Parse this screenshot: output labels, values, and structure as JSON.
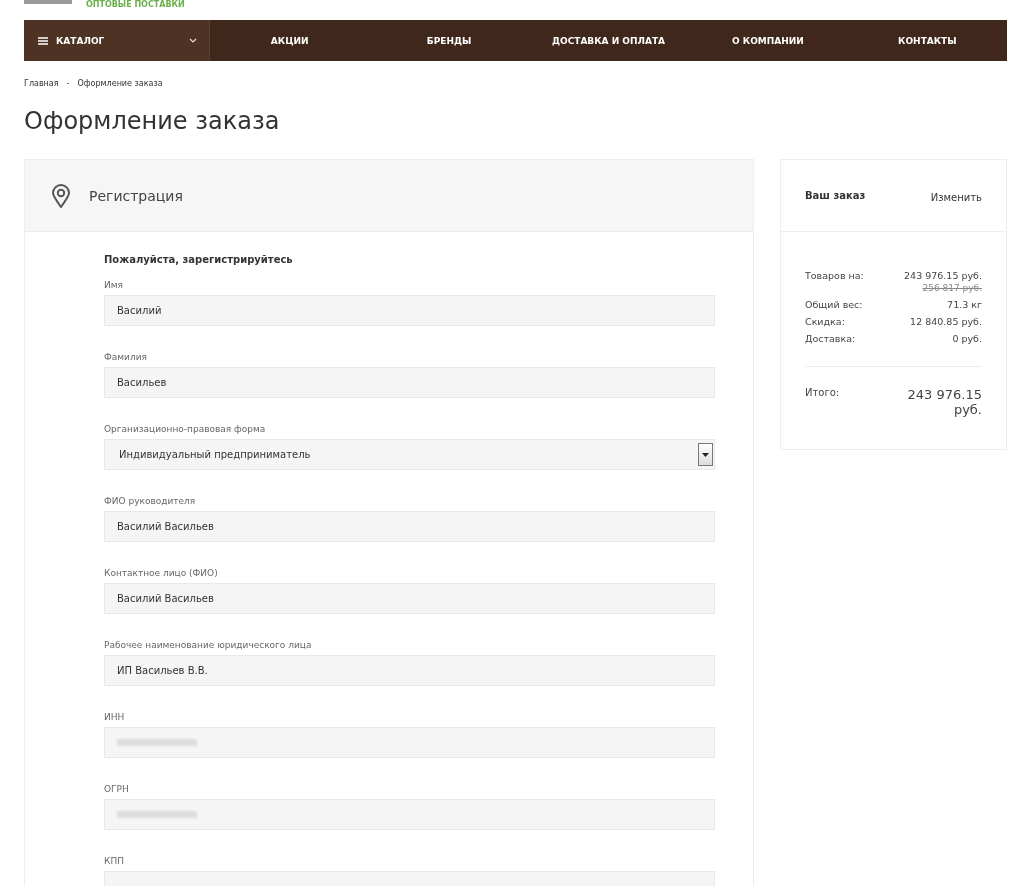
{
  "top_link": "ОПТОВЫЕ ПОСТАВКИ",
  "nav": {
    "catalog": {
      "label": "КАТАЛОГ",
      "expanded": false
    },
    "items": [
      "АКЦИИ",
      "БРЕНДЫ",
      "ДОСТАВКА И ОПЛАТА",
      "О КОМПАНИИ",
      "КОНТАКТЫ"
    ]
  },
  "breadcrumbs": [
    "Главная",
    "Оформление заказа"
  ],
  "breadcrumb_separator": "-",
  "page_title": "Оформление заказа",
  "registration": {
    "title": "Регистрация",
    "subtitle": "Пожалуйста, зарегистрируйтесь",
    "fields": [
      {
        "kind": "text",
        "label": "Имя",
        "value": "Василий"
      },
      {
        "kind": "text",
        "label": "Фамилия",
        "value": "Васильев"
      },
      {
        "kind": "select",
        "label": "Организационно-правовая форма",
        "value": "Индивидуальный предприниматель"
      },
      {
        "kind": "text",
        "label": "ФИО руководителя",
        "value": "Василий Васильев"
      },
      {
        "kind": "text",
        "label": "Контактное лицо (ФИО)",
        "value": "Василий Васильев"
      },
      {
        "kind": "text",
        "label": "Рабочее наименование юридического лица",
        "value": "ИП Васильев В.В."
      },
      {
        "kind": "redacted",
        "label": "ИНН"
      },
      {
        "kind": "redacted",
        "label": "ОГРН"
      },
      {
        "kind": "text",
        "label": "КПП"
      }
    ]
  },
  "order": {
    "title": "Ваш заказ",
    "edit_link": "Изменить",
    "rows": [
      {
        "label": "Товаров на:",
        "value": "243 976.15 руб.",
        "old_value": "256 817 руб."
      },
      {
        "label": "Общий вес:",
        "value": "71.3 кг"
      },
      {
        "label": "Скидка:",
        "value": "12 840.85 руб."
      },
      {
        "label": "Доставка:",
        "value": "0 руб."
      }
    ],
    "total_label": "Итого:",
    "total_value": "243 976.15 руб."
  }
}
